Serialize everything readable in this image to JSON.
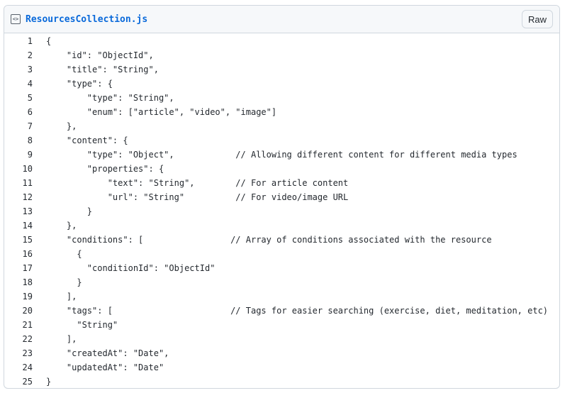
{
  "file": {
    "name": "ResourcesCollection.js",
    "raw_label": "Raw"
  },
  "lines": [
    "{",
    "    \"id\": \"ObjectId\",",
    "    \"title\": \"String\",",
    "    \"type\": {",
    "        \"type\": \"String\",",
    "        \"enum\": [\"article\", \"video\", \"image\"]",
    "    },",
    "    \"content\": {",
    "        \"type\": \"Object\",            // Allowing different content for different media types",
    "        \"properties\": {",
    "            \"text\": \"String\",        // For article content",
    "            \"url\": \"String\"          // For video/image URL",
    "        }",
    "    },",
    "    \"conditions\": [                 // Array of conditions associated with the resource",
    "      {",
    "        \"conditionId\": \"ObjectId\"",
    "      }",
    "    ],",
    "    \"tags\": [                       // Tags for easier searching (exercise, diet, meditation, etc)",
    "      \"String\"",
    "    ],",
    "    \"createdAt\": \"Date\",",
    "    \"updatedAt\": \"Date\"",
    "}"
  ]
}
